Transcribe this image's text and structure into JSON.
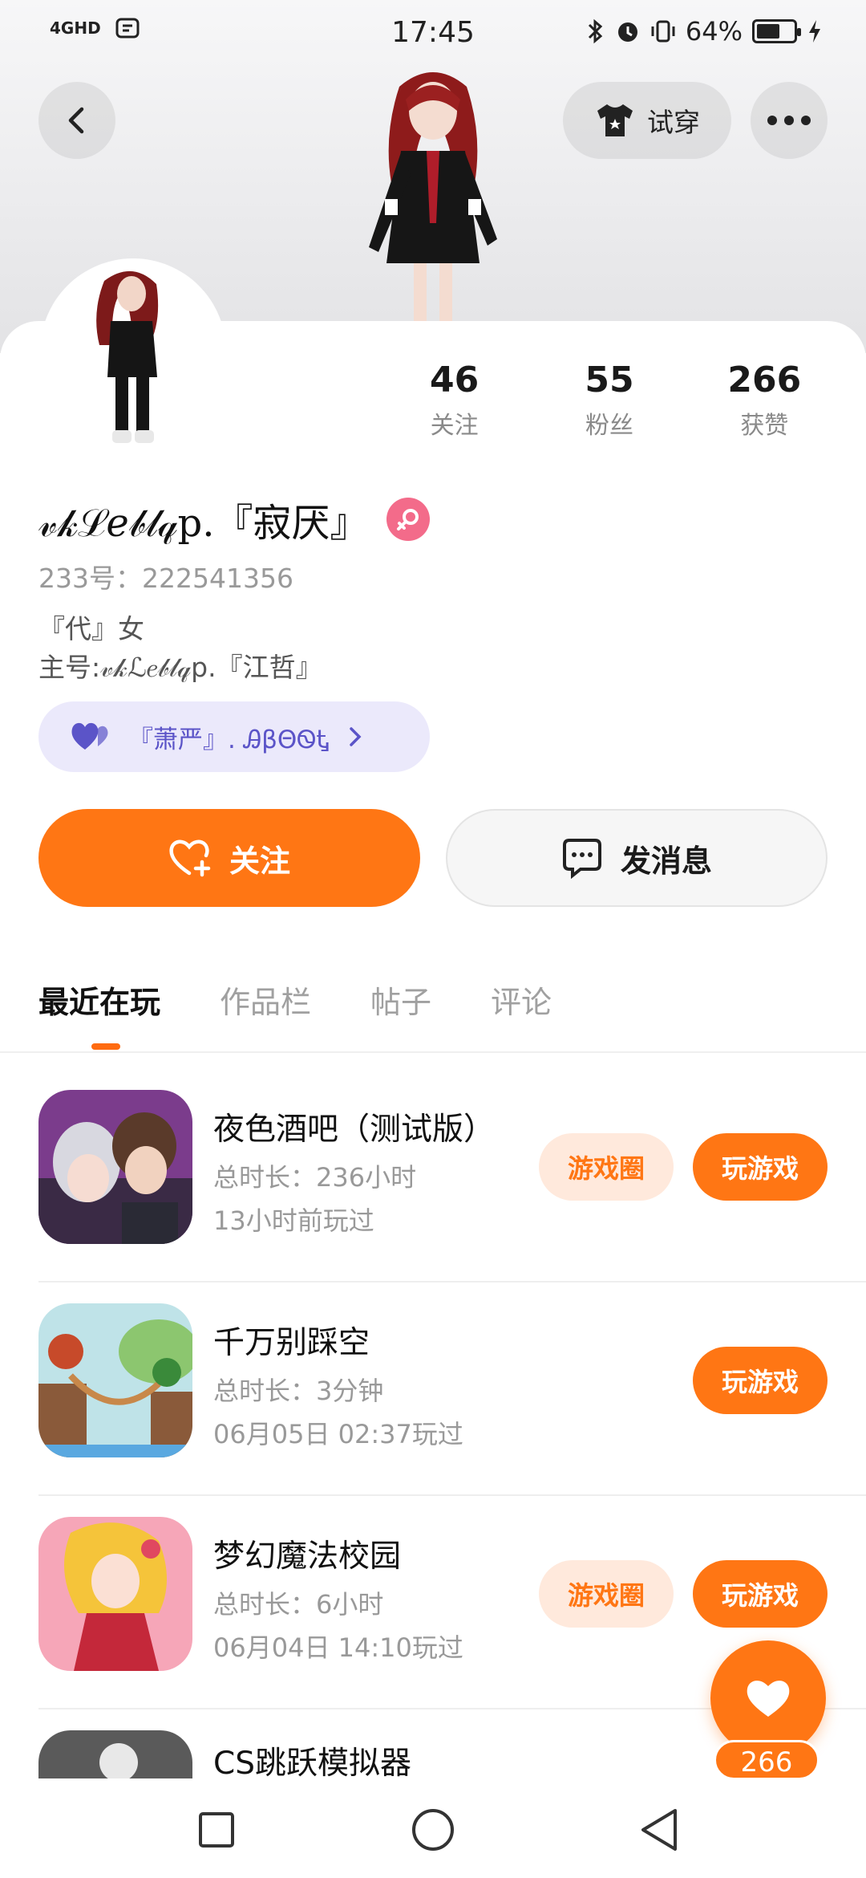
{
  "status_bar": {
    "network": "4GHD",
    "time": "17:45",
    "battery_percent": "64%",
    "battery_level": 0.64
  },
  "header": {
    "tryon_label": "试穿"
  },
  "profile": {
    "stats": [
      {
        "value": "46",
        "label": "关注"
      },
      {
        "value": "55",
        "label": "粉丝"
      },
      {
        "value": "266",
        "label": "获赞"
      }
    ],
    "name": "𝓋𝓀ℒ𝑒𝒷𝓁𝓆p.『寂厌』",
    "gender_icon": "female-icon",
    "uid": "233号：222541356",
    "bio_line1": "『代』女",
    "bio_line2": "主号:𝓋𝓀ℒ𝑒𝒷𝓁𝓆p.『江哲』",
    "club_label": "『萧严』. ᎯβΘᏫᎿ"
  },
  "actions": {
    "follow_label": "关注",
    "message_label": "发消息"
  },
  "tabs": [
    {
      "label": "最近在玩",
      "active": true
    },
    {
      "label": "作品栏",
      "active": false
    },
    {
      "label": "帖子",
      "active": false
    },
    {
      "label": "评论",
      "active": false
    }
  ],
  "games": [
    {
      "title": "夜色酒吧（测试版）",
      "playtime": "总时长：236小时",
      "last_played": "13小时前玩过",
      "circle_label": "游戏圈",
      "play_label": "玩游戏"
    },
    {
      "title": "千万别踩空",
      "playtime": "总时长：3分钟",
      "last_played": "06月05日 02:37玩过",
      "play_label": "玩游戏"
    },
    {
      "title": "梦幻魔法校园",
      "playtime": "总时长：6小时",
      "last_played": "06月04日 14:10玩过",
      "circle_label": "游戏圈",
      "play_label": "玩游戏"
    },
    {
      "title": "CS跳跃模拟器"
    }
  ],
  "like_fab": {
    "count": "266"
  },
  "colors": {
    "accent": "#ff7614",
    "accent_light": "#ffe9dc",
    "club_bg": "#ebe9fb",
    "club_text": "#5b54c8",
    "gender": "#f36b8a"
  }
}
